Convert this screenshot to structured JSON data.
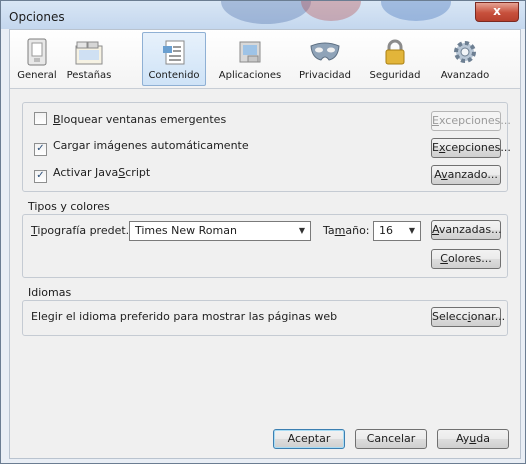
{
  "window": {
    "title": "Opciones",
    "close_label": "x"
  },
  "toolbar": {
    "items": [
      {
        "label": "General",
        "icon": "general-switch-icon",
        "selected": false
      },
      {
        "label": "Pestañas",
        "icon": "tabs-icon",
        "selected": false
      },
      {
        "label": "Contenido",
        "icon": "content-document-icon",
        "selected": true
      },
      {
        "label": "Aplicaciones",
        "icon": "applications-icon",
        "selected": false
      },
      {
        "label": "Privacidad",
        "icon": "privacy-mask-icon",
        "selected": false
      },
      {
        "label": "Seguridad",
        "icon": "security-lock-icon",
        "selected": false
      },
      {
        "label": "Avanzado",
        "icon": "advanced-gear-icon",
        "selected": false
      }
    ]
  },
  "popups": {
    "block_popups": {
      "label_key": "B",
      "label_rest": "loquear ventanas emergentes",
      "checked": false
    },
    "load_images": {
      "label": "Cargar imágenes automáticamente",
      "checked": true
    },
    "enable_js": {
      "label_pre": "Activar Java",
      "label_key": "S",
      "label_rest": "cript",
      "checked": true
    },
    "exceptions_disabled": {
      "pre": "",
      "key": "E",
      "rest": "xcepciones...",
      "enabled": false
    },
    "exceptions": {
      "pre": "E",
      "key": "x",
      "rest": "cepciones...",
      "enabled": true
    },
    "advanced": {
      "pre": "A",
      "key": "v",
      "rest": "anzado...",
      "enabled": true
    }
  },
  "fonts": {
    "group_title": "Tipos y colores",
    "default_font_label_key": "T",
    "default_font_label_rest": "ipografía predet.:",
    "default_font_value": "Times New Roman",
    "size_label_pre": "Ta",
    "size_label_key": "m",
    "size_label_rest": "año:",
    "size_value": "16",
    "advanced_pre": "",
    "advanced_key": "A",
    "advanced_rest": "vanzadas...",
    "colors_pre": "",
    "colors_key": "C",
    "colors_rest": "olores..."
  },
  "languages": {
    "group_title": "Idiomas",
    "description": "Elegir el idioma preferido para mostrar las páginas web",
    "choose_pre": "Selecc",
    "choose_key": "i",
    "choose_rest": "onar..."
  },
  "footer": {
    "accept": "Aceptar",
    "cancel": "Cancelar",
    "help_pre": "Ay",
    "help_key": "u",
    "help_rest": "da"
  },
  "colors": {
    "accent": "#8fb0d4",
    "window_frame": "#c4d7ee",
    "close": "#c7503c"
  }
}
